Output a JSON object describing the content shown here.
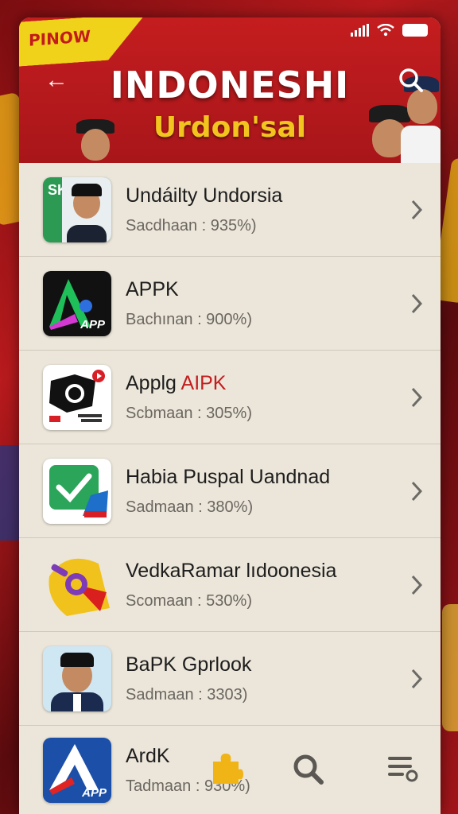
{
  "header": {
    "ribbon": "PINOW",
    "title": "INDONESHI",
    "subtitle": "Urdon'sal"
  },
  "apps": [
    {
      "name": "Undáilty Undorsia",
      "highlight": "",
      "sub": "Sacdhaan : 935%)"
    },
    {
      "name": "APPK",
      "highlight": "",
      "sub": "Bachınan : 900%)"
    },
    {
      "name": "Applg ",
      "highlight": "AIPK",
      "sub": "Scbmaan : 305%)"
    },
    {
      "name": "Habia Puspal Uandnad",
      "highlight": "",
      "sub": "Sadmaan : 380%)"
    },
    {
      "name": "VedkaRamar lıdoonesia",
      "highlight": "",
      "sub": "Scomaan : 530%)"
    },
    {
      "name": "BaPK Gprlook",
      "highlight": "",
      "sub": "Sadmaan : 3303)"
    },
    {
      "name": "ArdK",
      "highlight": "",
      "sub": "Tadmaan : 930%)"
    }
  ],
  "icon_labels": {
    "app1": "SK",
    "app2": "APP",
    "app7": "APP"
  },
  "icons": [
    "back-arrow-icon",
    "search-icon",
    "chevron-right-icon",
    "puzzle-icon",
    "magnifier-icon",
    "menu-list-icon"
  ],
  "colors": {
    "primary_red": "#c41d1f",
    "gold": "#f2c51e",
    "panel": "#ece6da"
  }
}
